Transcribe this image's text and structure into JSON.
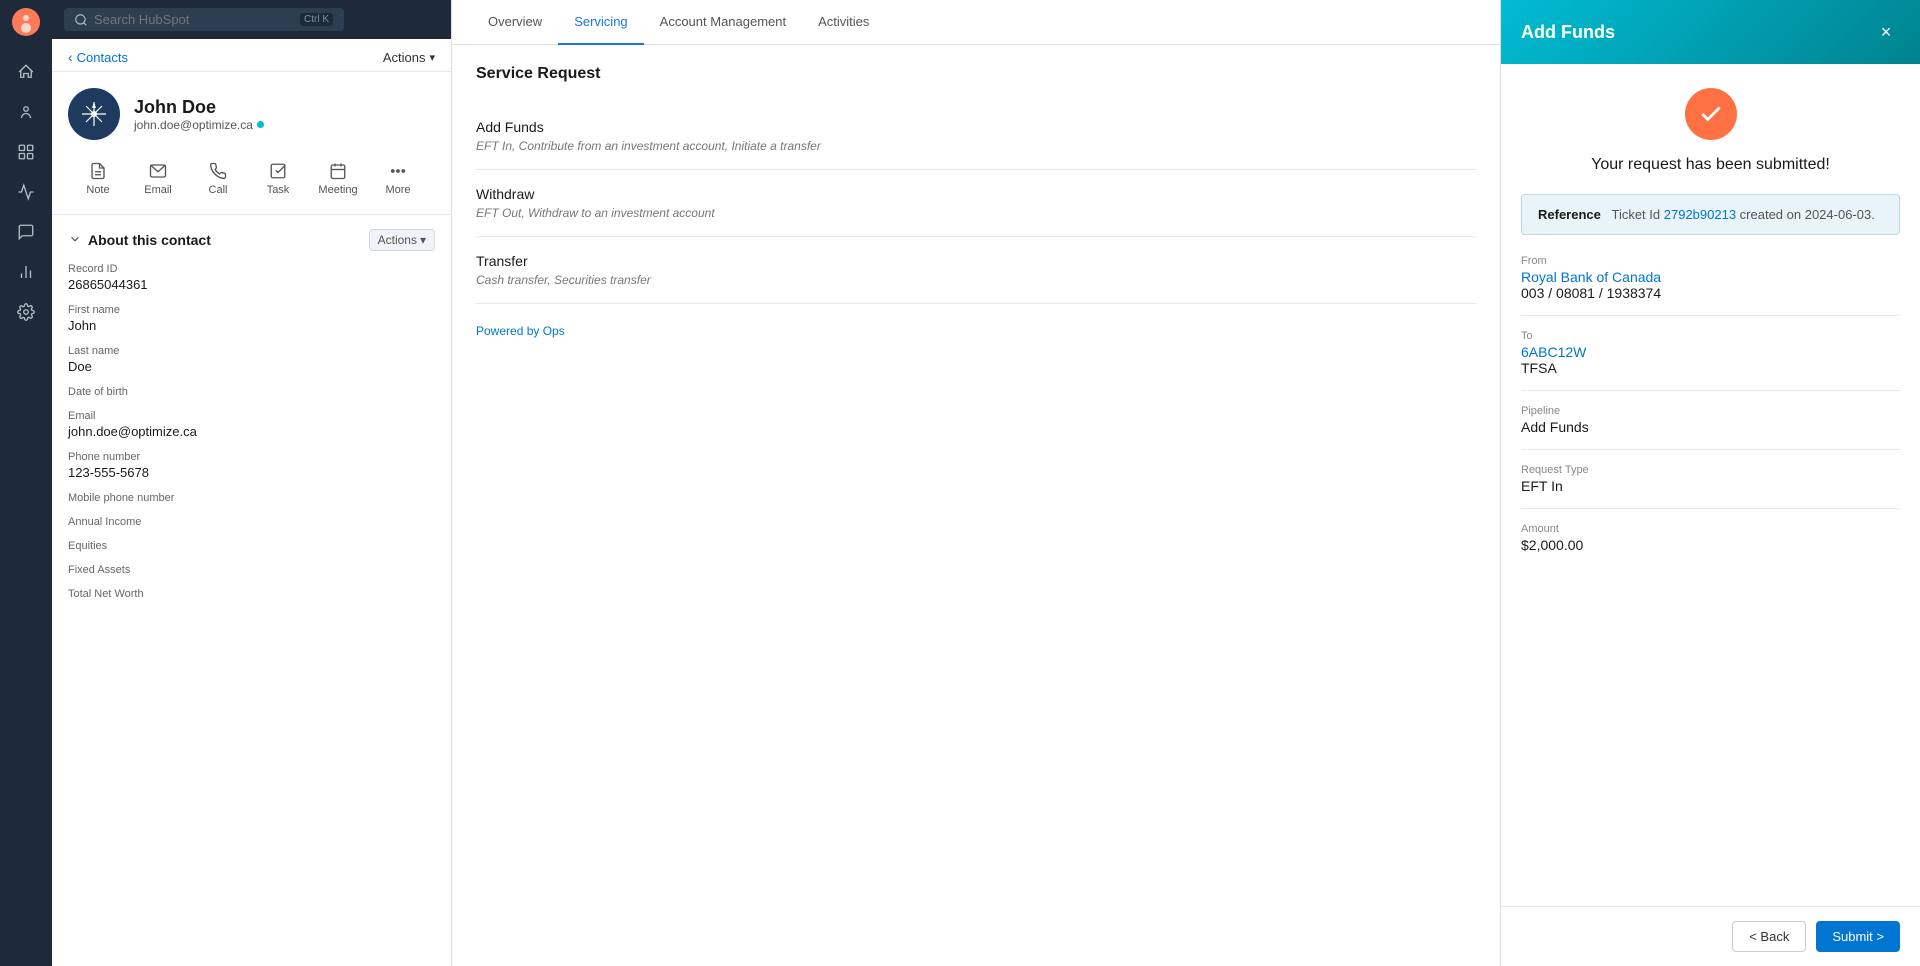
{
  "topbar": {
    "search_placeholder": "Search HubSpot",
    "shortcut": "Ctrl K"
  },
  "sidebar": {
    "back_label": "Contacts",
    "actions_label": "Actions",
    "contact": {
      "name": "John Doe",
      "email": "john.doe@optimize.ca"
    },
    "action_icons": [
      {
        "id": "note",
        "label": "Note"
      },
      {
        "id": "email",
        "label": "Email"
      },
      {
        "id": "call",
        "label": "Call"
      },
      {
        "id": "task",
        "label": "Task"
      },
      {
        "id": "meeting",
        "label": "Meeting"
      },
      {
        "id": "more",
        "label": "More"
      }
    ],
    "about_section": {
      "title": "About this contact",
      "actions_label": "Actions",
      "fields": [
        {
          "label": "Record ID",
          "value": "26865044361"
        },
        {
          "label": "First name",
          "value": "John"
        },
        {
          "label": "Last name",
          "value": "Doe"
        },
        {
          "label": "Date of birth",
          "value": ""
        },
        {
          "label": "Email",
          "value": "john.doe@optimize.ca"
        },
        {
          "label": "Phone number",
          "value": "123-555-5678"
        },
        {
          "label": "Mobile phone number",
          "value": ""
        },
        {
          "label": "Annual Income",
          "value": ""
        },
        {
          "label": "Equities",
          "value": ""
        },
        {
          "label": "Fixed Assets",
          "value": ""
        },
        {
          "label": "Total Net Worth",
          "value": ""
        }
      ]
    }
  },
  "tabs": [
    {
      "id": "overview",
      "label": "Overview",
      "active": false
    },
    {
      "id": "servicing",
      "label": "Servicing",
      "active": true
    },
    {
      "id": "account-management",
      "label": "Account Management",
      "active": false
    },
    {
      "id": "activities",
      "label": "Activities",
      "active": false
    }
  ],
  "content": {
    "section_title": "Service Request",
    "items": [
      {
        "id": "add-funds",
        "name": "Add Funds",
        "description": "EFT In, Contribute from an investment account, Initiate a transfer"
      },
      {
        "id": "withdraw",
        "name": "Withdraw",
        "description": "EFT Out, Withdraw to an investment account"
      },
      {
        "id": "transfer",
        "name": "Transfer",
        "description": "Cash transfer, Securities transfer"
      }
    ],
    "powered_by": "Powered by ",
    "powered_by_link": "Ops"
  },
  "panel": {
    "title": "Add Funds",
    "close_label": "×",
    "success_message": "Your request has been submitted!",
    "reference": {
      "label": "Reference",
      "text": "Ticket Id ",
      "ticket_id": "2792b90213",
      "date_text": " created on 2024-06-03."
    },
    "from_label": "From",
    "from_name": "Royal Bank of Canada",
    "from_account": "003 / 08081 / 1938374",
    "to_label": "To",
    "to_account": "6ABC12W",
    "to_type": "TFSA",
    "pipeline_label": "Pipeline",
    "pipeline_value": "Add Funds",
    "request_type_label": "Request Type",
    "request_type_value": "EFT In",
    "amount_label": "Amount",
    "amount_value": "$2,000.00",
    "footer": {
      "back_label": "< Back",
      "submit_label": "Submit >"
    }
  }
}
